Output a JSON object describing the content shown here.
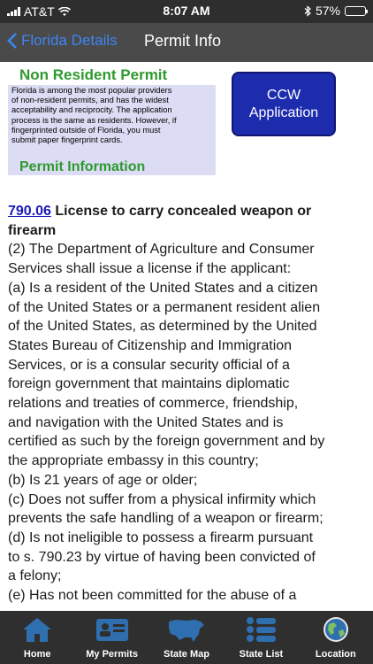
{
  "status": {
    "carrier": "AT&T",
    "time": "8:07 AM",
    "battery": "57%",
    "battery_level": 0.57
  },
  "nav": {
    "back_label": "Florida Details",
    "title": "Permit Info"
  },
  "non_resident": {
    "title": "Non Resident Permit",
    "lines": [
      "Florida is among the most popular providers",
      "of non-resident permits, and has the widest",
      "acceptability and reciprocity.  The application",
      "process is the same as residents.  However, if",
      "fingerprinted outside of Florida, you must",
      "submit paper fingerprint cards."
    ]
  },
  "ccw_button": {
    "line1": "CCW",
    "line2": "Application"
  },
  "permit_info": {
    "title": "Permit Information"
  },
  "statute": {
    "link": "790.06",
    "heading_line1": " License to carry concealed weapon or",
    "heading_line2": "firearm",
    "lines": [
      "(2) The Department of Agriculture and Consumer",
      "Services shall issue a license if the applicant:",
      "(a) Is a resident of the United States and a citizen",
      "of the United States or a permanent resident alien",
      "of the United States, as determined by the United",
      "States Bureau of Citizenship and Immigration",
      "Services, or is a consular security official of a",
      "foreign government that maintains diplomatic",
      "relations and treaties of commerce, friendship,",
      "and navigation with the United States and is",
      "certified as such by the foreign government and by",
      "the appropriate embassy in this country;",
      "(b) Is 21 years of age or older;",
      "(c) Does not suffer from a physical infirmity which",
      "prevents the safe handling of a weapon or firearm;",
      "(d) Is not ineligible to possess a firearm pursuant",
      "to s. 790.23 by virtue of having been convicted of",
      "a felony;",
      "(e) Has not been committed for the abuse of a"
    ]
  },
  "tabs": [
    {
      "label": "Home",
      "icon": "home-icon"
    },
    {
      "label": "My Permits",
      "icon": "id-card-icon"
    },
    {
      "label": "State Map",
      "icon": "us-map-icon"
    },
    {
      "label": "State List",
      "icon": "list-icon"
    },
    {
      "label": "Location",
      "icon": "globe-icon"
    }
  ]
}
